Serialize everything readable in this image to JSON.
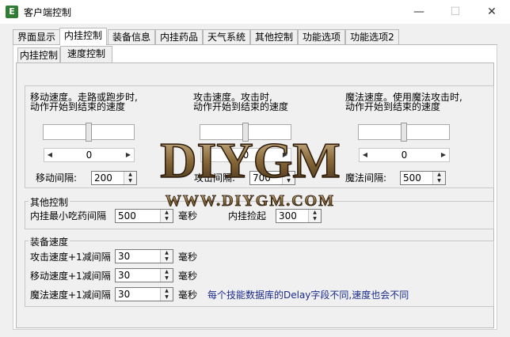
{
  "window": {
    "title": "客户端控制",
    "app_icon": "E",
    "minimize": "—",
    "maximize": "☐",
    "close": "✕"
  },
  "tabs": [
    "界面显示",
    "内挂控制",
    "装备信息",
    "内挂药品",
    "天气系统",
    "其他控制",
    "功能选项",
    "功能选项2"
  ],
  "subtabs": [
    "内挂控制",
    "速度控制"
  ],
  "speed": {
    "move_desc": [
      "移动速度。走路或跑步时,",
      "动作开始到结束的速度"
    ],
    "attack_desc": [
      "攻击速度。攻击时,",
      "动作开始到结束的速度"
    ],
    "magic_desc": [
      "魔法速度。使用魔法攻击时,",
      "动作开始到结束的速度"
    ],
    "move_value": "0",
    "attack_value": "0",
    "magic_value": "0",
    "move_interval_label": "移动间隔:",
    "move_interval": "200",
    "attack_interval_label": "攻击间隔:",
    "attack_interval": "700",
    "magic_interval_label": "魔法间隔:",
    "magic_interval": "500"
  },
  "other": {
    "title": "其他控制",
    "eat_label": "内挂最小吃药间隔",
    "eat_value": "500",
    "eat_unit": "毫秒",
    "pickup_label": "内挂捡起",
    "pickup_value": "300"
  },
  "equip": {
    "title": "装备速度",
    "attack_label": "攻击速度+1减间隔",
    "attack_value": "30",
    "move_label": "移动速度+1减间隔",
    "move_value": "30",
    "magic_label": "魔法速度+1减间隔",
    "magic_value": "30",
    "unit": "毫秒",
    "note": "每个技能数据库的Delay字段不同,速度也会不同"
  },
  "watermark": {
    "brand": "DIYGM",
    "url": "WWW.DIYGM.COM"
  },
  "colors": {
    "note": "#1a2a8c",
    "window_bg": "#f0f0f0",
    "watermark": "#8a6a3a"
  }
}
